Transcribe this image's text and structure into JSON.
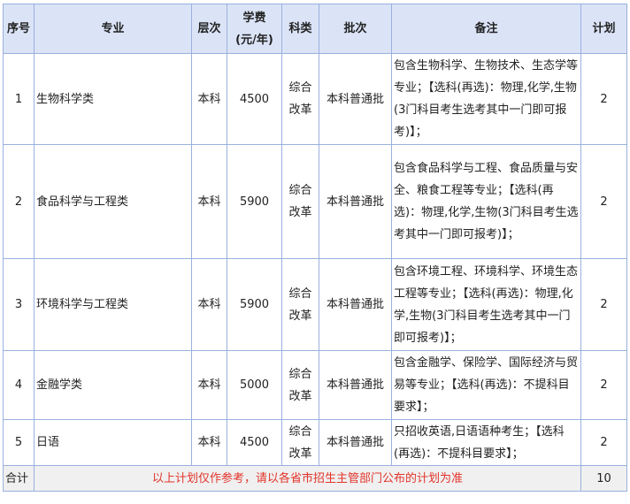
{
  "headers": {
    "index": "序号",
    "major": "专业",
    "level": "层次",
    "fee_line1": "学费",
    "fee_line2": "(元/年)",
    "subject": "科类",
    "batch": "批次",
    "remarks": "备注",
    "plan": "计划"
  },
  "rows": [
    {
      "index": "1",
      "major": "生物科学类",
      "level": "本科",
      "fee": "4500",
      "subject": "综合改革",
      "batch": "本科普通批",
      "remarks": "包含生物科学、生物技术、生态学等专业；【选科(再选)：物理,化学,生物(3门科目考生选考其中一门即可报考)】；",
      "plan": "2"
    },
    {
      "index": "2",
      "major": "食品科学与工程类",
      "level": "本科",
      "fee": "5900",
      "subject": "综合改革",
      "batch": "本科普通批",
      "remarks": "包含食品科学与工程、食品质量与安全、粮食工程等专业；【选科(再选)：物理,化学,生物(3门科目考生选考其中一门即可报考)】；",
      "plan": "2"
    },
    {
      "index": "3",
      "major": "环境科学与工程类",
      "level": "本科",
      "fee": "5900",
      "subject": "综合改革",
      "batch": "本科普通批",
      "remarks": "包含环境工程、环境科学、环境生态工程等专业；【选科(再选)：物理,化学,生物(3门科目考生选考其中一门即可报考)】；",
      "plan": "2"
    },
    {
      "index": "4",
      "major": "金融学类",
      "level": "本科",
      "fee": "5000",
      "subject": "综合改革",
      "batch": "本科普通批",
      "remarks": "包含金融学、保险学、国际经济与贸易等专业；【选科(再选)：不提科目要求】；",
      "plan": "2"
    },
    {
      "index": "5",
      "major": "日语",
      "level": "本科",
      "fee": "4500",
      "subject": "综合改革",
      "batch": "本科普通批",
      "remarks": "只招收英语,日语语种考生；【选科(再选)：不提科目要求】；",
      "plan": "2"
    }
  ],
  "footer": {
    "label": "合计",
    "note": "以上计划仅作参考，请以各省市招生主管部门公布的计划为准",
    "total": "10"
  }
}
